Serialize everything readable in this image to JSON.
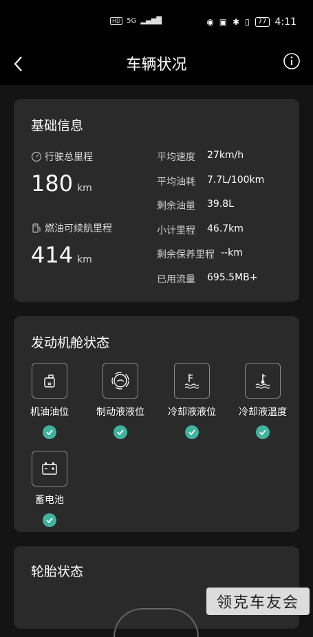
{
  "status_bar": {
    "hd": "HD",
    "signal": "5G",
    "battery": "77",
    "time": "4:11"
  },
  "header": {
    "title": "车辆状况"
  },
  "basic_info": {
    "title": "基础信息",
    "total_mileage_label": "行驶总里程",
    "total_mileage_value": "180",
    "total_mileage_unit": "km",
    "fuel_range_label": "燃油可续航里程",
    "fuel_range_value": "414",
    "fuel_range_unit": "km",
    "metrics": [
      {
        "label": "平均速度",
        "value": "27km/h"
      },
      {
        "label": "平均油耗",
        "value": "7.7L/100km"
      },
      {
        "label": "剩余油量",
        "value": "39.8L"
      },
      {
        "label": "小计里程",
        "value": "46.7km"
      },
      {
        "label": "剩余保养里程",
        "value": "--km"
      },
      {
        "label": "已用流量",
        "value": "695.5MB+"
      }
    ]
  },
  "engine": {
    "title": "发动机舱状态",
    "items": [
      {
        "label": "机油油位"
      },
      {
        "label": "制动液液位"
      },
      {
        "label": "冷却液液位"
      },
      {
        "label": "冷却液温度"
      },
      {
        "label": "蓄电池"
      }
    ]
  },
  "tire": {
    "title": "轮胎状态"
  },
  "watermark": "领克车友会",
  "colors": {
    "background": "#141414",
    "card": "#2a2a2a",
    "ok": "#3fb39e"
  }
}
